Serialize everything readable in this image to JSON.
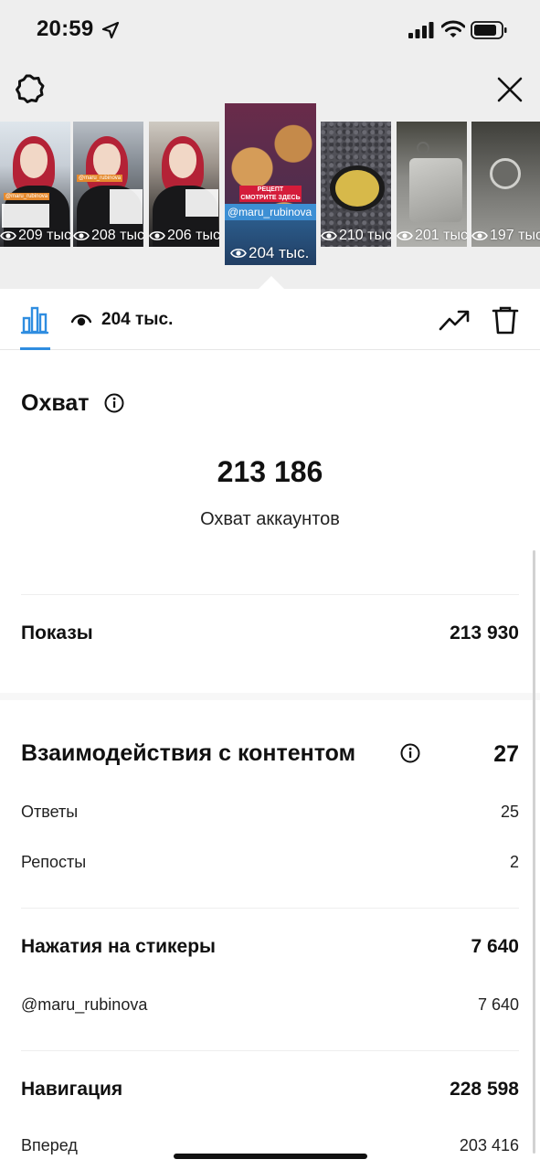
{
  "status_bar": {
    "time": "20:59"
  },
  "thumbnails": [
    {
      "views": "209 тыс.",
      "tag": "@maru_rubinova"
    },
    {
      "views": "208 тыс.",
      "tag": "@maru_rubinova"
    },
    {
      "views": "206 тыс."
    },
    {
      "views": "204 тыс.",
      "sticker": "@maru_rubinova",
      "banner": "РЕЦЕПТ СМОТРИТЕ ЗДЕСЬ"
    },
    {
      "views": "210 тыс."
    },
    {
      "views": "201 тыс."
    },
    {
      "views": "197 тыс."
    }
  ],
  "toolbar": {
    "views": "204 тыс."
  },
  "reach": {
    "title": "Охват",
    "value": "213 186",
    "caption": "Охват аккаунтов"
  },
  "impressions": {
    "label": "Показы",
    "value": "213 930"
  },
  "interactions": {
    "title": "Взаимодействия с контентом",
    "value": "27",
    "rows": [
      {
        "label": "Ответы",
        "value": "25"
      },
      {
        "label": "Репосты",
        "value": "2"
      }
    ]
  },
  "sticker_taps": {
    "label": "Нажатия на стикеры",
    "value": "7 640",
    "rows": [
      {
        "label": "@maru_rubinova",
        "value": "7 640"
      }
    ]
  },
  "navigation": {
    "label": "Навигация",
    "value": "228 598",
    "rows": [
      {
        "label": "Вперед",
        "value": "203 416"
      }
    ]
  }
}
